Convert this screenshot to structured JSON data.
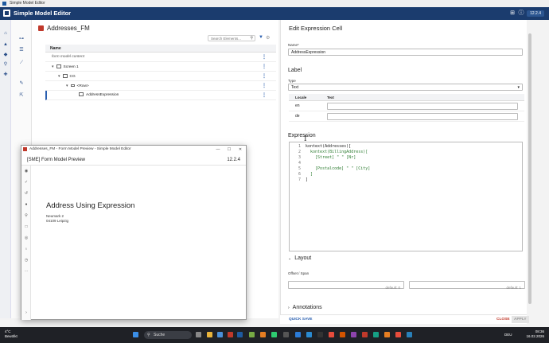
{
  "window": {
    "title": "Simple Model Editor"
  },
  "app": {
    "title": "Simple Model Editor",
    "version": "12.2.4"
  },
  "main": {
    "title": "Addresses_FM",
    "search_placeholder": "Search Elements...",
    "column_name": "Name",
    "tree": [
      {
        "label": "form model content"
      },
      {
        "label": "Screen 1"
      },
      {
        "label": "CG"
      },
      {
        "label": "<Row>"
      },
      {
        "label": "AddressExpression"
      }
    ]
  },
  "editor": {
    "title": "Edit Expression Cell",
    "name_label": "Name*",
    "name_value": "AddressExpression",
    "label_section": "Label",
    "type_label": "Type",
    "type_value": "Text",
    "locale_header": "Locale",
    "text_header": "Text",
    "locales": [
      {
        "locale": "en"
      },
      {
        "locale": "de"
      }
    ],
    "expression_section": "Expression",
    "code": [
      "kontext(Addresses)[",
      "  kontext(BillingAddress)[",
      "    [Street] \" \" [Nr]",
      "",
      "    [Postalcode] \" \" [City]",
      "  ]",
      "]"
    ],
    "layout_section": "Layout",
    "offset_label": "Offset / Span",
    "offset_default": "default: 0",
    "span_default": "default: 1",
    "annotations_section": "Annotations",
    "quick_save": "QUICK SAVE",
    "close": "CLOSE",
    "apply": "APPLY"
  },
  "preview": {
    "window_title": "Addresses_FM - Form Model Preview - Simple Model Editor",
    "header": "[SME] Form Model Preview",
    "version": "12.2.4",
    "heading": "Address Using Expression",
    "address_line1": "Neumark 2",
    "address_line2": "04109 Leipzig"
  },
  "taskbar": {
    "temp": "4°C",
    "weather": "Bewölkt",
    "search": "Suche",
    "lang": "DEU",
    "time": "08:36",
    "date": "16.02.2026"
  }
}
